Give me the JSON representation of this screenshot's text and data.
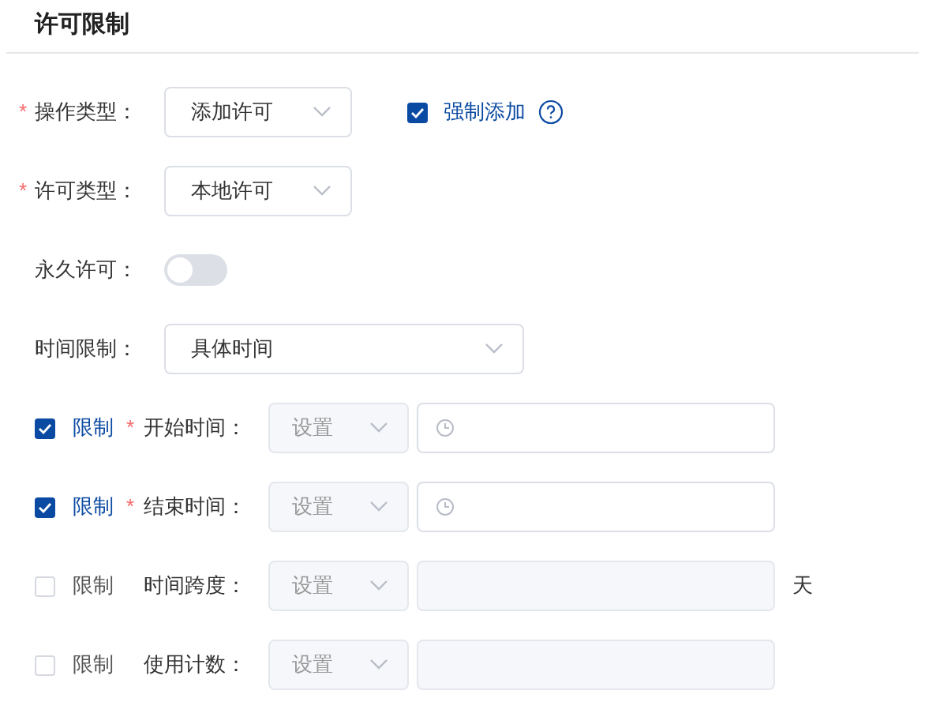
{
  "title": "许可限制",
  "fields": [
    {
      "kind": "select",
      "mark": "*",
      "label": "操作类型：",
      "value": "添加许可",
      "checkbox": {
        "label": "强制添加",
        "checked": true,
        "help": true
      }
    },
    {
      "kind": "select",
      "mark": "*",
      "label": "许可类型：",
      "value": "本地许可"
    },
    {
      "kind": "switch",
      "label": "永久许可：",
      "on": false
    },
    {
      "kind": "wideselect",
      "label": "时间限制：",
      "value": "具体时间"
    }
  ],
  "limits": [
    {
      "kind": "time",
      "check_label": "限制",
      "checked": true,
      "mark": "*",
      "label": "开始时间：",
      "select_value": "设置"
    },
    {
      "kind": "time",
      "check_label": "限制",
      "checked": true,
      "mark": "*",
      "label": "结束时间：",
      "select_value": "设置"
    },
    {
      "kind": "number",
      "check_label": "限制",
      "checked": false,
      "label": "时间跨度：",
      "select_value": "设置",
      "suffix": "天"
    },
    {
      "kind": "number",
      "check_label": "限制",
      "checked": false,
      "label": "使用计数：",
      "select_value": "设置"
    }
  ]
}
